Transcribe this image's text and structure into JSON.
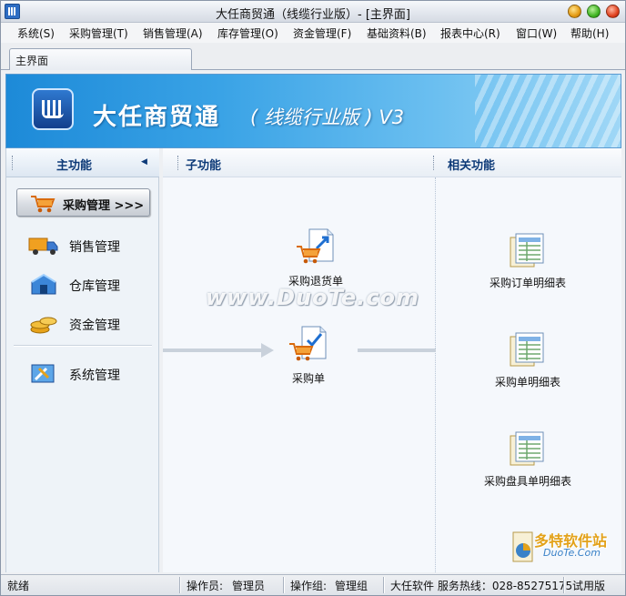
{
  "window": {
    "title": "大任商贸通（线缆行业版）- [主界面]"
  },
  "menu": [
    "系统(S)",
    "采购管理(T)",
    "销售管理(A)",
    "库存管理(O)",
    "资金管理(F)",
    "基础资料(B)",
    "报表中心(R)",
    "窗口(W)",
    "帮助(H)"
  ],
  "tabs": {
    "main": "主界面"
  },
  "banner": {
    "title": "大任商贸通",
    "subtitle": "( 线缆行业版 ) V3"
  },
  "left": {
    "header": "主功能",
    "collapse_glyph": "◀",
    "active": "采购管理 >>>",
    "items": {
      "sales": "销售管理",
      "warehouse": "仓库管理",
      "funds": "资金管理",
      "system": "系统管理"
    }
  },
  "columns": {
    "sub": "子功能",
    "related": "相关功能"
  },
  "functions": {
    "return": "采购退货单",
    "order": "采购单"
  },
  "related": {
    "order_detail": "采购订单明细表",
    "purchase_detail": "采购单明细表",
    "stock_detail": "采购盘具单明细表"
  },
  "watermark": "www.DuoTe.com",
  "corner": {
    "name": "多特软件站",
    "url": "DuoTe.Com"
  },
  "status": {
    "ready": "就绪",
    "operator_label": "操作员:",
    "operator": "管理员",
    "group_label": "操作组:",
    "group": "管理组",
    "hotline": "大任软件 服务热线：028-85275175",
    "edition": "试用版"
  },
  "colors": {
    "banner": "#3aa3e6",
    "header_text": "#0d3a78"
  }
}
